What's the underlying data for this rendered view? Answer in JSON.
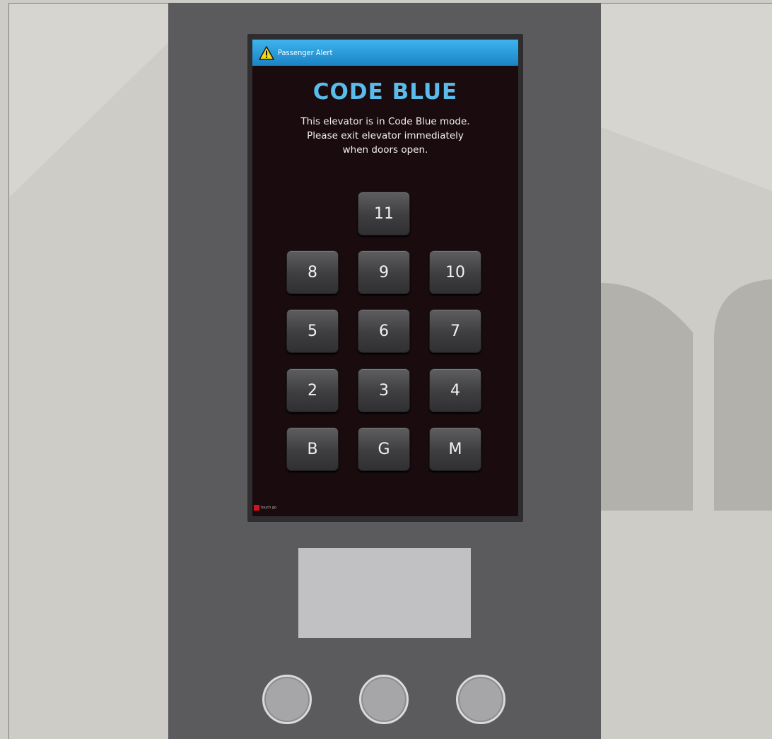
{
  "alert_bar": {
    "label": "Passenger Alert",
    "icon": "warning-icon"
  },
  "screen": {
    "title": "CODE BLUE",
    "message_lines": [
      "This elevator is in Code Blue mode.",
      "Please exit elevator immediately",
      "when doors open."
    ],
    "brand": "touch go"
  },
  "floor_keys": [
    {
      "label": "11",
      "row": 0,
      "col": 1
    },
    {
      "label": "8",
      "row": 1,
      "col": 0
    },
    {
      "label": "9",
      "row": 1,
      "col": 1
    },
    {
      "label": "10",
      "row": 1,
      "col": 2
    },
    {
      "label": "5",
      "row": 2,
      "col": 0
    },
    {
      "label": "6",
      "row": 2,
      "col": 1
    },
    {
      "label": "7",
      "row": 2,
      "col": 2
    },
    {
      "label": "2",
      "row": 3,
      "col": 0
    },
    {
      "label": "3",
      "row": 3,
      "col": 1
    },
    {
      "label": "4",
      "row": 3,
      "col": 2
    },
    {
      "label": "B",
      "row": 4,
      "col": 0
    },
    {
      "label": "G",
      "row": 4,
      "col": 1
    },
    {
      "label": "M",
      "row": 4,
      "col": 2
    }
  ],
  "colors": {
    "accent": "#5bbbea",
    "alert_bar": "#2a9ddc",
    "screen_bg": "#1a0c0e",
    "panel": "#5b5b5e",
    "wall": "#cdccc6"
  }
}
